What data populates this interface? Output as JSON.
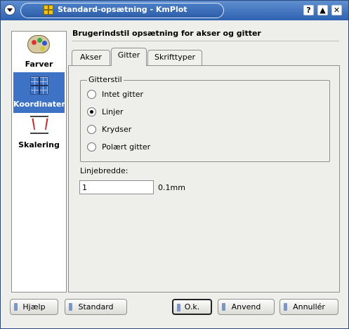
{
  "window": {
    "title": "Standard-opsætning - KmPlot",
    "help_glyph": "?",
    "minimize_glyph": "▲",
    "close_glyph": "✕"
  },
  "sidebar": {
    "items": [
      {
        "label": "Farver",
        "icon": "palette-icon",
        "active": false
      },
      {
        "label": "Koordinater",
        "icon": "coordinate-grid-icon",
        "active": true
      },
      {
        "label": "Skalering",
        "icon": "scaling-icon",
        "active": false
      }
    ]
  },
  "page": {
    "title": "Brugerindstil opsætning for akser og gitter"
  },
  "tabs": [
    {
      "label": "Akser",
      "active": false
    },
    {
      "label": "Gitter",
      "active": true
    },
    {
      "label": "Skrifttyper",
      "active": false
    }
  ],
  "gridstyle": {
    "title": "Gitterstil",
    "options": [
      {
        "label": "Intet gitter",
        "checked": false
      },
      {
        "label": "Linjer",
        "checked": true
      },
      {
        "label": "Krydser",
        "checked": false
      },
      {
        "label": "Polært gitter",
        "checked": false
      }
    ]
  },
  "linewidth": {
    "label": "Linjebredde:",
    "value": "1",
    "unit": "0.1mm"
  },
  "buttons": {
    "help": "Hjælp",
    "default": "Standard",
    "ok": "O.k.",
    "apply": "Anvend",
    "cancel": "Annullér"
  },
  "colors": {
    "accent": "#3e72c4",
    "titlebar": "#2f62b0",
    "background": "#eeeeea"
  }
}
